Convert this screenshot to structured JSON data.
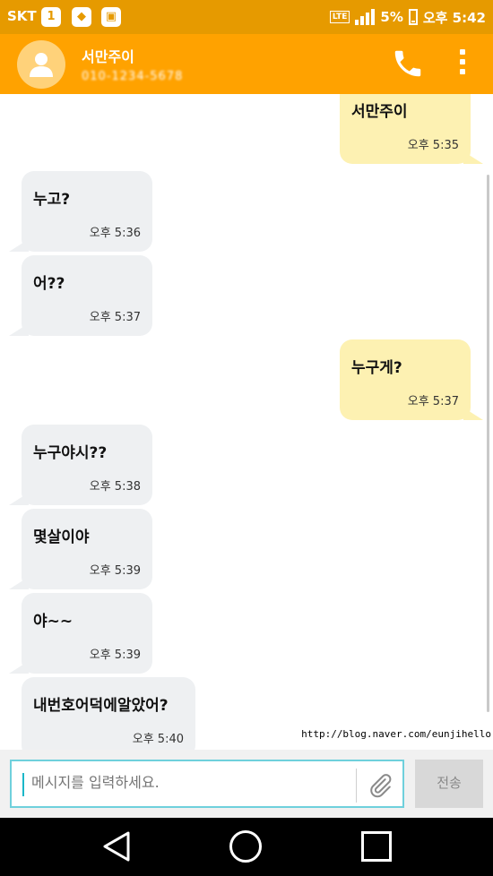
{
  "status_bar": {
    "carrier": "SKT",
    "notif_icons": [
      "1",
      "pin-app-icon",
      "bag-icon"
    ],
    "network": "LTE",
    "battery": "5%",
    "clock": "오후 5:42"
  },
  "header": {
    "contact_name": "서만주이",
    "contact_number": "010-1234-5678",
    "icons": [
      "avatar-person-icon",
      "phone-icon",
      "overflow-menu-icon"
    ]
  },
  "messages": [
    {
      "side": "out",
      "text": "서만주이",
      "time": "오후 5:35"
    },
    {
      "side": "in",
      "text": "누고?",
      "time": "오후 5:36"
    },
    {
      "side": "in",
      "text": "어??",
      "time": "오후 5:37"
    },
    {
      "side": "out",
      "text": "누구게?",
      "time": "오후 5:37"
    },
    {
      "side": "in",
      "text": "누구야시??",
      "time": "오후 5:38"
    },
    {
      "side": "in",
      "text": "몇살이야",
      "time": "오후 5:39"
    },
    {
      "side": "in",
      "text": "야~~",
      "time": "오후 5:39"
    },
    {
      "side": "in",
      "text": "내번호어덕에알았어?",
      "time": "오후 5:40"
    }
  ],
  "watermark": "http://blog.naver.com/eunjihello",
  "composer": {
    "placeholder": "메시지를 입력하세요.",
    "send_label": "전송"
  },
  "nav": [
    "back-icon",
    "home-icon",
    "recents-icon"
  ],
  "colors": {
    "status_bar": "#e69a00",
    "header": "#ffa200",
    "incoming_bubble": "#eef0f2",
    "outgoing_bubble": "#fdf1b2",
    "input_border": "#6fd0dc"
  }
}
